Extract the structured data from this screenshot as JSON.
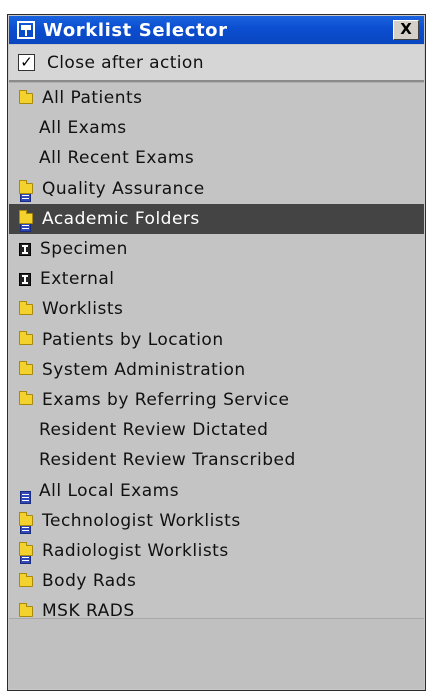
{
  "window": {
    "title": "Worklist Selector",
    "close_glyph": "X",
    "close_after_action": {
      "label": "Close after action",
      "checked": true,
      "check_glyph": "✓"
    }
  },
  "worklist": {
    "selected_index": 4,
    "items": [
      {
        "label": "All Patients",
        "icon": "folder-icon"
      },
      {
        "label": "All Exams",
        "icon": "list-icon"
      },
      {
        "label": "All Recent Exams",
        "icon": "list-icon"
      },
      {
        "label": "Quality Assurance",
        "icon": "folder-icon"
      },
      {
        "label": "Academic Folders",
        "icon": "folder-icon"
      },
      {
        "label": "Specimen",
        "icon": "specimen-icon"
      },
      {
        "label": "External",
        "icon": "specimen-icon"
      },
      {
        "label": "Worklists",
        "icon": "folder-icon"
      },
      {
        "label": "Patients by Location",
        "icon": "folder-icon"
      },
      {
        "label": "System Administration",
        "icon": "folder-icon"
      },
      {
        "label": "Exams by Referring Service",
        "icon": "folder-icon"
      },
      {
        "label": "Resident Review Dictated",
        "icon": "list-icon"
      },
      {
        "label": "Resident Review Transcribed",
        "icon": "list-icon"
      },
      {
        "label": "All Local Exams",
        "icon": "list-icon"
      },
      {
        "label": "Technologist Worklists",
        "icon": "folder-icon"
      },
      {
        "label": "Radiologist Worklists",
        "icon": "folder-icon"
      },
      {
        "label": "Body Rads",
        "icon": "folder-icon"
      },
      {
        "label": "MSK RADS",
        "icon": "folder-icon"
      }
    ]
  },
  "colors": {
    "titlebar": "#0b4ed0",
    "selected_row": "#444444",
    "folder": "#f3d22e",
    "list_icon": "#2f49b8"
  }
}
